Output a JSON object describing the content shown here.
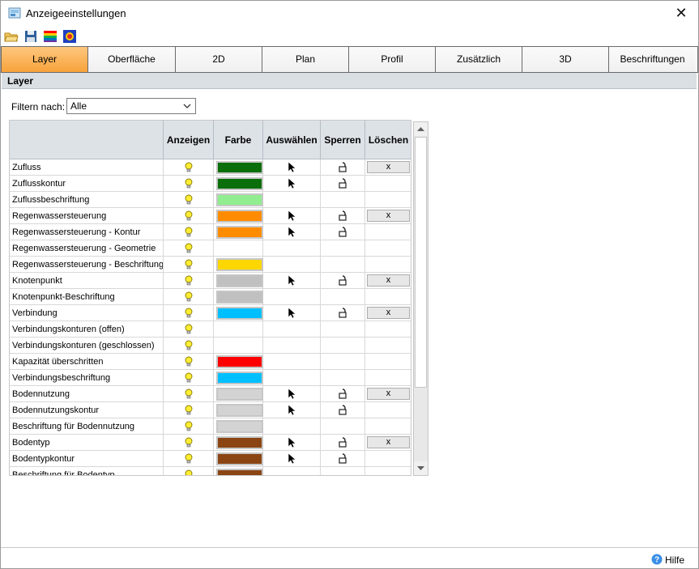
{
  "window": {
    "title": "Anzeigeeinstellungen"
  },
  "toolbar": {
    "buttons": [
      "open-folder-icon",
      "save-disk-icon",
      "color-palette-icon",
      "paint-settings-icon"
    ]
  },
  "tabs": [
    {
      "label": "Layer",
      "active": true
    },
    {
      "label": "Oberfläche"
    },
    {
      "label": "2D"
    },
    {
      "label": "Plan"
    },
    {
      "label": "Profil"
    },
    {
      "label": "Zusätzlich"
    },
    {
      "label": "3D"
    },
    {
      "label": "Beschriftungen"
    }
  ],
  "section": {
    "title": "Layer"
  },
  "filter": {
    "label": "Filtern nach:",
    "value": "Alle"
  },
  "grid": {
    "columns": [
      "",
      "Anzeigen",
      "Farbe",
      "Auswählen",
      "Sperren",
      "Löschen"
    ],
    "delete_label": "x",
    "rows": [
      {
        "name": "Zufluss",
        "color": "#0a6e0a",
        "select": true,
        "lock": true,
        "delete": true
      },
      {
        "name": "Zuflusskontur",
        "color": "#0a6e0a",
        "select": true,
        "lock": true,
        "delete": false
      },
      {
        "name": "Zuflussbeschriftung",
        "color": "#90ee90",
        "select": false,
        "lock": false,
        "delete": false
      },
      {
        "name": "Regenwassersteuerung",
        "color": "#ff8c00",
        "select": true,
        "lock": true,
        "delete": true
      },
      {
        "name": "Regenwassersteuerung - Kontur",
        "color": "#ff8c00",
        "select": true,
        "lock": true,
        "delete": false
      },
      {
        "name": "Regenwassersteuerung - Geometrie",
        "color": null,
        "select": false,
        "lock": false,
        "delete": false
      },
      {
        "name": "Regenwassersteuerung - Beschriftung",
        "color": "#ffd700",
        "select": false,
        "lock": false,
        "delete": false
      },
      {
        "name": "Knotenpunkt",
        "color": "#c0c0c0",
        "select": true,
        "lock": true,
        "delete": true
      },
      {
        "name": "Knotenpunkt-Beschriftung",
        "color": "#c0c0c0",
        "select": false,
        "lock": false,
        "delete": false
      },
      {
        "name": "Verbindung",
        "color": "#00bfff",
        "select": true,
        "lock": true,
        "delete": true
      },
      {
        "name": "Verbindungskonturen (offen)",
        "color": null,
        "select": false,
        "lock": false,
        "delete": false
      },
      {
        "name": "Verbindungskonturen (geschlossen)",
        "color": null,
        "select": false,
        "lock": false,
        "delete": false
      },
      {
        "name": "Kapazität überschritten",
        "color": "#ff0000",
        "select": false,
        "lock": false,
        "delete": false
      },
      {
        "name": "Verbindungsbeschriftung",
        "color": "#00bfff",
        "select": false,
        "lock": false,
        "delete": false
      },
      {
        "name": "Bodennutzung",
        "color": "#d3d3d3",
        "select": true,
        "lock": true,
        "delete": true
      },
      {
        "name": "Bodennutzungskontur",
        "color": "#d3d3d3",
        "select": true,
        "lock": true,
        "delete": false
      },
      {
        "name": "Beschriftung für Bodennutzung",
        "color": "#d3d3d3",
        "select": false,
        "lock": false,
        "delete": false
      },
      {
        "name": "Bodentyp",
        "color": "#8b4513",
        "select": true,
        "lock": true,
        "delete": true
      },
      {
        "name": "Bodentypkontur",
        "color": "#8b4513",
        "select": true,
        "lock": true,
        "delete": false
      },
      {
        "name": "Beschriftung für Bodentyp",
        "color": "#8b4513",
        "select": false,
        "lock": false,
        "delete": false
      }
    ]
  },
  "footer": {
    "help_label": "Hilfe"
  }
}
